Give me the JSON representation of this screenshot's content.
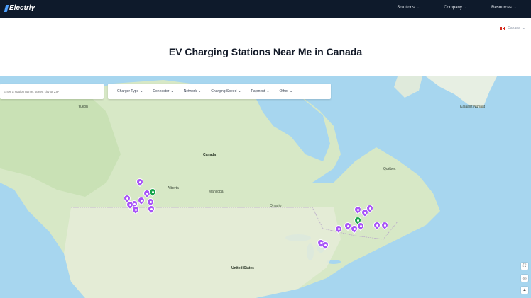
{
  "header": {
    "logo_text": "Electrly",
    "nav": [
      {
        "label": "Solutions"
      },
      {
        "label": "Company"
      },
      {
        "label": "Resources"
      }
    ]
  },
  "country_selector": {
    "label": "Canada"
  },
  "page_title": "EV Charging Stations Near Me in Canada",
  "search": {
    "placeholder": "Enter a station name, street, city or ZIP"
  },
  "filters": [
    {
      "label": "Charger Type"
    },
    {
      "label": "Connector"
    },
    {
      "label": "Network"
    },
    {
      "label": "Charging Speed"
    },
    {
      "label": "Payment"
    },
    {
      "label": "Other"
    }
  ],
  "map_labels": {
    "canada": "Canada",
    "region_nw": "Yukon",
    "greenland": "Kalaallit Nunaat",
    "region_mid1": "Alberta",
    "region_mid2": "Manitoba",
    "region_mid3": "Ontario",
    "region_east": "Québec",
    "us": "United States"
  },
  "colors": {
    "nav_bg": "#0e1a2b",
    "pin_purple": "#a855f7",
    "pin_green": "#16a34a",
    "water": "#a7d6ef",
    "land": "#d7e8c6"
  },
  "map_controls": [
    {
      "icon": "fullscreen-icon"
    },
    {
      "icon": "locate-icon"
    },
    {
      "icon": "layers-icon"
    }
  ]
}
